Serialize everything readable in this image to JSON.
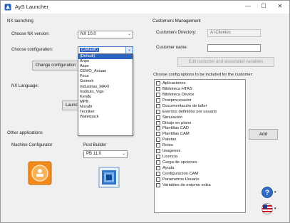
{
  "window": {
    "title": "AyS Launcher",
    "controls": {
      "minimize": "—",
      "maximize": "☐",
      "close": "✕"
    }
  },
  "nx_launching": {
    "section_label": "NX launching",
    "version_label": "Choose NX version:",
    "version_value": "NX 10.0",
    "config_label": "Choose configuration:",
    "config_value": "(Default)",
    "change_config_button": "Change configuration",
    "language_label": "NX Language:",
    "launch_button": "Launch",
    "config_options": [
      "(Default)",
      "Anpo",
      "Aspe",
      "CEMO_Actuan",
      "Foca",
      "Goimek",
      "Industrias_MAXI",
      "Instituto_Vigo",
      "Kendu",
      "MPB",
      "Novalti",
      "Tecniker",
      "Waterpack"
    ],
    "config_selected_index": 0
  },
  "other_applications": {
    "section_label": "Other applications",
    "machine_configurator_label": "Machine Configurator",
    "post_builder_label": "Post Builder",
    "post_builder_version": "PB 11.0"
  },
  "customers": {
    "section_label": "Customers Management",
    "directory_label": "Customers Directory:",
    "directory_value": "A:\\Clientes",
    "name_label": "Customer name:",
    "name_value": "",
    "edit_button": "Edit customer and associated variables",
    "options_label": "Choose config options to be included for the customer:",
    "add_button": "Add",
    "options": [
      "Aplicaciones",
      "Biblioteca HTAS",
      "Biblioteca Device",
      "Postprocesador",
      "Documentación de taller",
      "Eventos definidos por usuario",
      "Simulación",
      "Dibujo en plano",
      "Plantillas CAD",
      "Plantillas CAM",
      "Paletas",
      "Roles",
      "Imagenes",
      "Licencia",
      "Carga de opciones",
      "Ayuda",
      "Configuracion CAM",
      "Parametros Usuario",
      "Variables de entorno extra"
    ]
  },
  "icons": {
    "help": "help-icon",
    "language": "flag-icon",
    "machine": "machine-configurator-icon",
    "post_builder": "post-builder-icon"
  },
  "colors": {
    "selection": "#2a63c2",
    "accent_orange": "#f08a1c",
    "help_blue": "#2f6bc4"
  }
}
